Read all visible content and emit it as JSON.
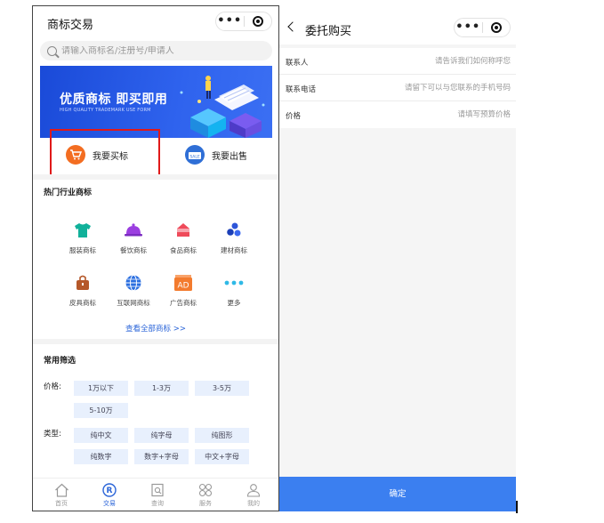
{
  "left_screen": {
    "title": "商标交易",
    "search": {
      "placeholder": "请输入商标名/注册号/申请人"
    },
    "banner": {
      "title": "优质商标 即买即用",
      "subtitle": "HIGH QUALITY TRADEMARK USE FORM"
    },
    "actions": [
      {
        "label": "我要买标",
        "icon": "shopping-cart-icon",
        "color": "#f36d21"
      },
      {
        "label": "我要出售",
        "icon": "sale-tag-icon",
        "color": "#2f6fd6"
      }
    ],
    "hot_section_title": "热门行业商标",
    "categories": [
      {
        "label": "服装商标",
        "icon": "tshirt-icon",
        "color": "#11b19a"
      },
      {
        "label": "餐饮商标",
        "icon": "dish-cover-icon",
        "color": "#9b3ee0"
      },
      {
        "label": "食品商标",
        "icon": "cake-icon",
        "color": "#ef4a5a"
      },
      {
        "label": "建材商标",
        "icon": "building-blocks-icon",
        "color": "#2d55d9"
      },
      {
        "label": "皮具商标",
        "icon": "handbag-icon",
        "color": "#b5582a"
      },
      {
        "label": "互联网商标",
        "icon": "globe-icon",
        "color": "#2b6fe0"
      },
      {
        "label": "广告商标",
        "icon": "ad-icon",
        "color": "#f37b2e"
      },
      {
        "label": "更多",
        "icon": "more-dots-icon",
        "color": "#2fb9e6"
      }
    ],
    "view_all": "查看全部商标 >>",
    "filter_section_title": "常用筛选",
    "filters": {
      "price_label": "价格:",
      "price_options": [
        "1万以下",
        "1-3万",
        "3-5万",
        "5-10万"
      ],
      "type_label": "类型:",
      "type_options": [
        "纯中文",
        "纯字母",
        "纯图形",
        "纯数字",
        "数字+字母",
        "中文+字母"
      ]
    },
    "tabs": [
      {
        "label": "首页",
        "icon": "home-icon",
        "active": false
      },
      {
        "label": "交易",
        "icon": "trademark-r-icon",
        "active": true
      },
      {
        "label": "查询",
        "icon": "search-doc-icon",
        "active": false
      },
      {
        "label": "服务",
        "icon": "grid-service-icon",
        "active": false
      },
      {
        "label": "我的",
        "icon": "user-icon",
        "active": false
      }
    ],
    "accent_color": "#2a64d8",
    "highlight_color": "#e01919"
  },
  "right_screen": {
    "title": "委托购买",
    "fields": [
      {
        "label": "联系人",
        "placeholder": "请告诉我们如何称呼您"
      },
      {
        "label": "联系电话",
        "placeholder": "请留下可以与您联系的手机号码"
      },
      {
        "label": "价格",
        "placeholder": "请填写预算价格"
      }
    ],
    "confirm_label": "确定",
    "confirm_color": "#3b7ff0"
  }
}
